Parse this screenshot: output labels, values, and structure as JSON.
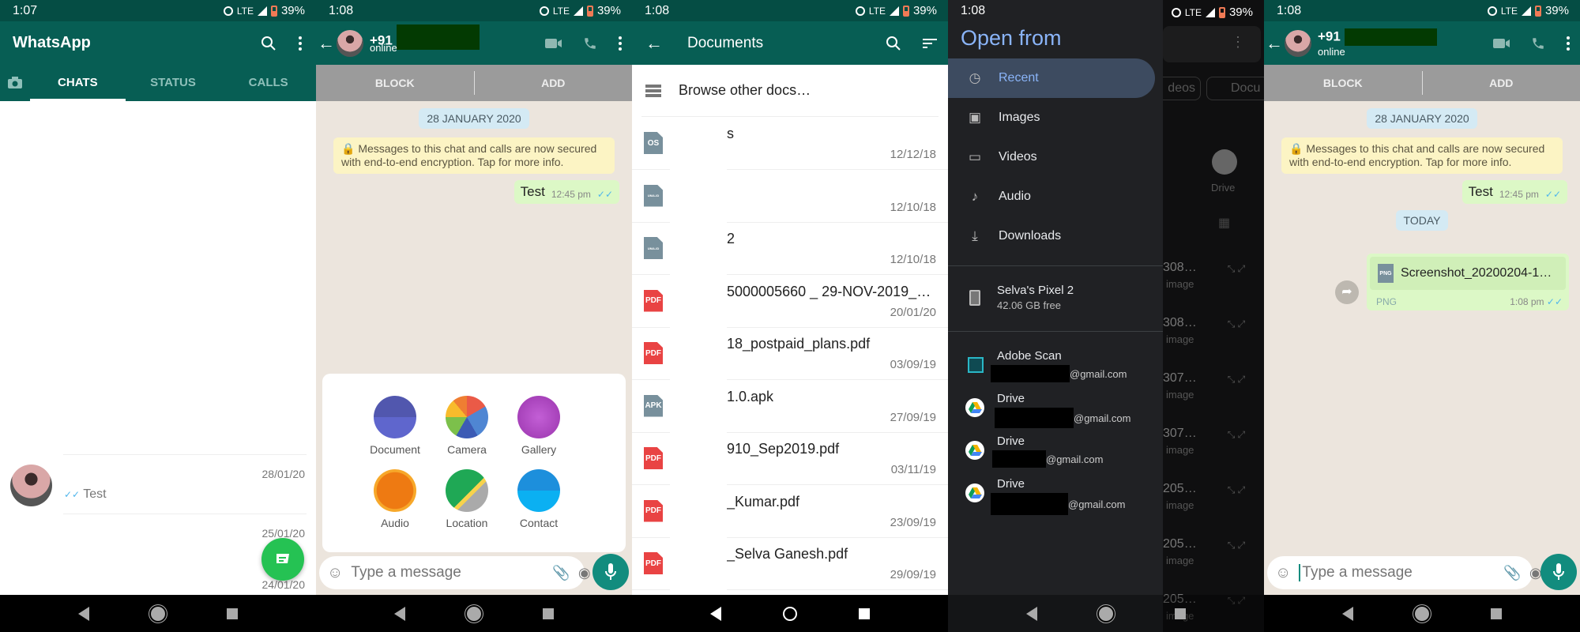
{
  "status": {
    "p1_time": "1:07",
    "time": "1:08",
    "network": "LTE",
    "battery": "39%"
  },
  "chats_screen": {
    "title": "WhatsApp",
    "tabs": [
      "CHATS",
      "STATUS",
      "CALLS"
    ],
    "active_tab": "CHATS",
    "chats": [
      {
        "date": "28/01/20",
        "preview": "Test",
        "ticks": "✓✓"
      },
      {
        "date": "25/01/20",
        "preview": ""
      },
      {
        "date": "24/01/20",
        "preview": ""
      }
    ]
  },
  "chat_screen": {
    "contact_prefix": "+91",
    "contact_status": "online",
    "block_label": "BLOCK",
    "add_label": "ADD",
    "date_chip": "28 JANUARY 2020",
    "encryption_notice": "Messages to this chat and calls are now secured with end-to-end encryption. Tap for more info.",
    "messages": [
      {
        "text": "Test",
        "time": "12:45 pm",
        "ticks": "✓✓"
      }
    ],
    "input_placeholder": "Type a message",
    "attach_menu": [
      {
        "label": "Document",
        "icon": "document-icon",
        "color": "#5157ae"
      },
      {
        "label": "Camera",
        "icon": "camera-icon",
        "color": "#ea5a47"
      },
      {
        "label": "Gallery",
        "icon": "gallery-icon",
        "color": "#a33cb4"
      },
      {
        "label": "Audio",
        "icon": "headphones-icon",
        "color": "#f0820f"
      },
      {
        "label": "Location",
        "icon": "location-icon",
        "color": "#1fa855"
      },
      {
        "label": "Contact",
        "icon": "contact-icon",
        "color": "#0ea5e9"
      }
    ]
  },
  "documents_screen": {
    "title": "Documents",
    "browse_label": "Browse other docs…",
    "files": [
      {
        "type": "OS",
        "name": "s",
        "date": "12/12/18",
        "color": "#78909c"
      },
      {
        "type": "UMA-ID",
        "name": "",
        "date": "12/10/18",
        "color": "#78909c"
      },
      {
        "type": "UMA-ID",
        "name": "2",
        "date": "12/10/18",
        "color": "#78909c"
      },
      {
        "type": "PDF",
        "name": "5000005660 _ 29-NOV-2019_…",
        "date": "20/01/20",
        "color": "#e94343"
      },
      {
        "type": "PDF",
        "name": "18_postpaid_plans.pdf",
        "date": "03/09/19",
        "color": "#e94343"
      },
      {
        "type": "APK",
        "name": "1.0.apk",
        "date": "27/09/19",
        "color": "#78909c"
      },
      {
        "type": "PDF",
        "name": "910_Sep2019.pdf",
        "date": "03/11/19",
        "color": "#e94343"
      },
      {
        "type": "PDF",
        "name": "_Kumar.pdf",
        "date": "23/09/19",
        "color": "#e94343"
      },
      {
        "type": "PDF",
        "name": "_Selva Ganesh.pdf",
        "date": "29/09/19",
        "color": "#e94343"
      }
    ]
  },
  "open_from": {
    "title": "Open from",
    "items": [
      {
        "label": "Recent",
        "icon": "clock-icon",
        "active": true
      },
      {
        "label": "Images",
        "icon": "image-icon"
      },
      {
        "label": "Videos",
        "icon": "video-icon"
      },
      {
        "label": "Audio",
        "icon": "music-note-icon"
      },
      {
        "label": "Downloads",
        "icon": "download-icon"
      }
    ],
    "device": {
      "name": "Selva's Pixel 2",
      "free": "42.06 GB free"
    },
    "accounts": [
      {
        "name": "Adobe Scan",
        "email_suffix": "@gmail.com"
      },
      {
        "name": "Drive",
        "email_suffix": "@gmail.com"
      },
      {
        "name": "Drive",
        "email_suffix": "@gmail.com"
      },
      {
        "name": "Drive",
        "email_suffix": "@gmail.com"
      }
    ],
    "background": {
      "chips": [
        "deos",
        "Docu"
      ],
      "drive_label": "Drive",
      "files": [
        "308…",
        "308…",
        "307…",
        "307…",
        "205…",
        "205…",
        "205…"
      ],
      "file_sub": "image"
    }
  },
  "chat_screen_2": {
    "today_chip": "TODAY",
    "file_message": {
      "name": "Screenshot_20200204-1…",
      "type": "PNG",
      "time": "1:08 pm",
      "ticks": "✓✓"
    }
  }
}
